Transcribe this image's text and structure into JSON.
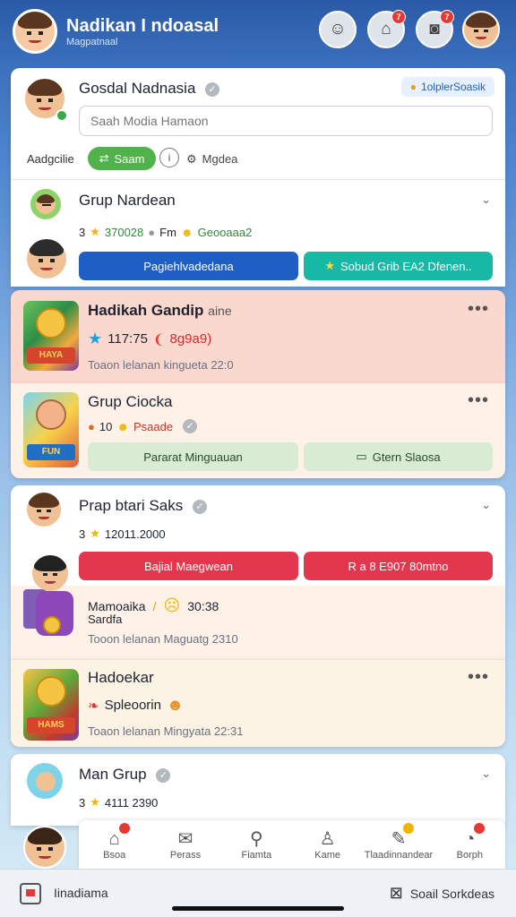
{
  "header": {
    "title": "Nadikan I ndoasal",
    "subtitle": "Magpatnaal",
    "badges": {
      "home": "7",
      "camera": "7"
    }
  },
  "composer": {
    "name": "Gosdal Nadnasia",
    "tag": "1olplerSoasik",
    "placeholder": "Saah Modia Hamaon",
    "row_label": "Aadgcilie",
    "green_pill": "Saam",
    "third": "Mgdea"
  },
  "card_grup": {
    "title": "Grup Nardean",
    "count": "3",
    "number": "370028",
    "mid": "Fm",
    "tail": "Geooaaa2",
    "btn_blue": "Pagiehlvadedana",
    "btn_teal": "Sobud Grib EA2 Dfenen.."
  },
  "card_hadikah": {
    "title": "Hadikah Gandip",
    "title_suffix": "aine",
    "stat": "117:75",
    "stat_red": "8g9a9)",
    "sub": "Toaon lelanan kingueta 22:0",
    "thumb_text": "HAYA"
  },
  "card_grup_cioka": {
    "title": "Grup Ciocka",
    "meta": "10",
    "meta2": "Psaade",
    "btn_left": "Pararat Minguauan",
    "btn_right": "Gtern Slaosa",
    "thumb_text": "FUN"
  },
  "card_prap": {
    "title": "Prap btari Saks",
    "count": "3",
    "number": "12011.2000",
    "btn_red_left": "Bajial Maegwean",
    "btn_red_right": "R a 8 E907 80mtno",
    "line1": "Mamoaika",
    "line1_time": "30:38",
    "line1b": "Sardfa",
    "sub": "Tooon lelanan Maguatg 2310"
  },
  "card_hadoekar": {
    "title": "Hadoekar",
    "line": "Spleoorin",
    "sub": "Toaon lelanan Mingyata 22:31",
    "thumb_text": "HAMS"
  },
  "card_man": {
    "title": "Man Grup",
    "count": "3",
    "number": "4111 2390"
  },
  "bottom_nav": [
    {
      "label": "Bsoa",
      "icon": "home-icon"
    },
    {
      "label": "Perass",
      "icon": "mail-icon"
    },
    {
      "label": "Fiamta",
      "icon": "search-icon"
    },
    {
      "label": "Kame",
      "icon": "person-icon"
    },
    {
      "label": "Tlaadinnandear",
      "icon": "inbox-icon"
    },
    {
      "label": "Borph",
      "icon": "globe-icon"
    }
  ],
  "footer": {
    "left": "Iinadiama",
    "right": "Soail Sorkdeas"
  },
  "colors": {
    "blue_btn": "#1f5fc5",
    "teal_btn": "#17b8a6",
    "red_btn": "#e3374d",
    "salmon_card": "#fbd8cd",
    "peach_card": "#fdf1e8",
    "green_pill": "#4fb24a"
  }
}
